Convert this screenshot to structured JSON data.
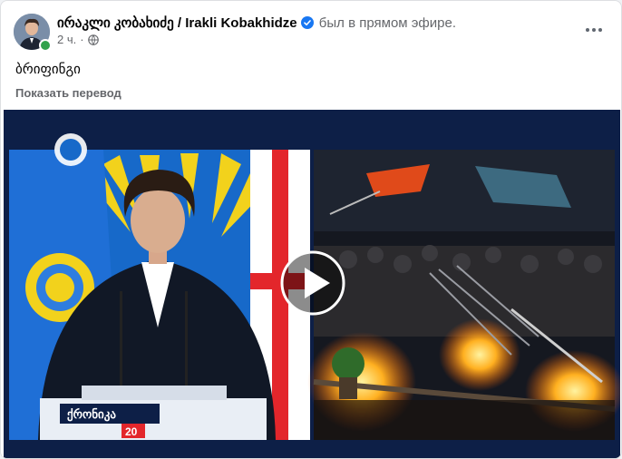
{
  "post": {
    "author": "ირაკლი კობახიძე / Irakli Kobakhidze",
    "action": "был в прямом эфире.",
    "time": "2 ч.",
    "separator": "·",
    "privacy_icon": "globe-icon",
    "text": "ბრიფინგი",
    "translate_link": "Показать перевод"
  },
  "video": {
    "ticker_text": "ქრონიკა",
    "channel_number": "20"
  },
  "colors": {
    "verified": "#1877f2",
    "online": "#31a24c",
    "secondary_text": "#65676b",
    "video_background": "#0d1f47"
  }
}
